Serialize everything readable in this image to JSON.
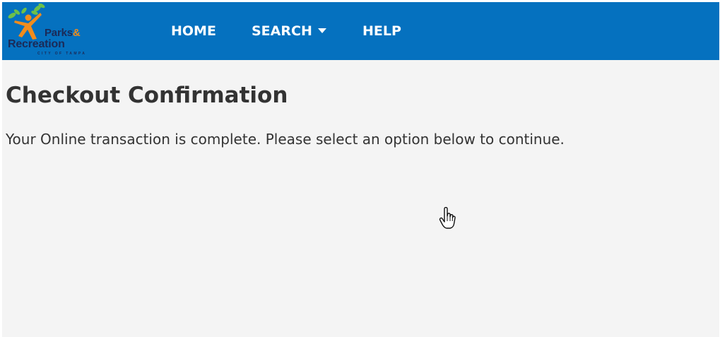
{
  "nav": {
    "logo": {
      "line1": "Parks",
      "line1_amp": "&",
      "line2": "Recreation",
      "line3": "CITY OF TAMPA"
    },
    "items": [
      {
        "label": "HOME"
      },
      {
        "label": "SEARCH"
      },
      {
        "label": "HELP"
      }
    ]
  },
  "main": {
    "title": "Checkout Confirmation",
    "message": "Your Online transaction is complete. Please select an option below to continue."
  },
  "colors": {
    "navbar": "#0571bf",
    "page_background": "#f4f4f4",
    "text": "#333333",
    "logo_orange": "#f28c1c",
    "logo_green": "#6cc04a",
    "logo_navy": "#1b2a57"
  },
  "icons": {
    "logo": "parks-figure-with-leaves",
    "search_dropdown": "caret-down-icon",
    "cursor": "hand-pointer-icon"
  }
}
